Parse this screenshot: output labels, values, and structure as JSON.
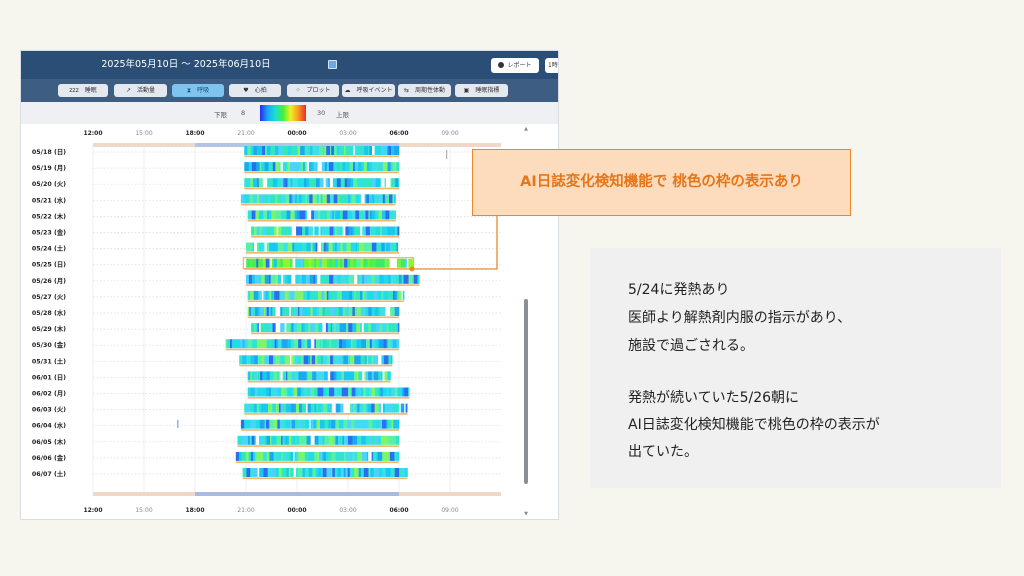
{
  "app": {
    "date_range": "2025年05月10日 〜 2025年06月10日",
    "report_button": "レポート",
    "period_button": "1時",
    "tabs": [
      {
        "icon": "zzz",
        "label": "睡眠",
        "active": false
      },
      {
        "icon": "↗",
        "label": "活動量",
        "active": false
      },
      {
        "icon": "lungs",
        "label": "呼吸",
        "active": true
      },
      {
        "icon": "♥",
        "label": "心拍",
        "active": false
      },
      {
        "icon": "⁘",
        "label": "プロット",
        "active": false
      },
      {
        "icon": "cloud",
        "label": "呼吸イベント",
        "active": false
      },
      {
        "icon": "⇆",
        "label": "周期性体動",
        "active": false
      },
      {
        "icon": "▣",
        "label": "睡眠指標",
        "active": false
      }
    ],
    "scale": {
      "lower_label": "下限",
      "lower_value": "8",
      "upper_value": "30",
      "upper_label": "上限"
    }
  },
  "chart_data": {
    "type": "heatmap",
    "time_ticks": [
      "12:00",
      "15:00",
      "18:00",
      "21:00",
      "00:00",
      "03:00",
      "06:00",
      "09:00"
    ],
    "time_ticks_bold": [
      true,
      false,
      true,
      false,
      true,
      false,
      true,
      false
    ],
    "rows": [
      {
        "date": "05/18 (日)",
        "start": 20.9,
        "end": 30.0,
        "highlight": false
      },
      {
        "date": "05/19 (月)",
        "start": 20.9,
        "end": 30.0,
        "highlight": false
      },
      {
        "date": "05/20 (火)",
        "start": 20.9,
        "end": 30.0,
        "highlight": false
      },
      {
        "date": "05/21 (水)",
        "start": 20.7,
        "end": 29.8,
        "highlight": false
      },
      {
        "date": "05/22 (木)",
        "start": 21.1,
        "end": 29.8,
        "highlight": false
      },
      {
        "date": "05/23 (金)",
        "start": 21.3,
        "end": 30.0,
        "highlight": false
      },
      {
        "date": "05/24 (土)",
        "start": 21.0,
        "end": 30.0,
        "highlight": false
      },
      {
        "date": "05/25 (日)",
        "start": 20.9,
        "end": 30.8,
        "highlight": true
      },
      {
        "date": "05/26 (月)",
        "start": 21.0,
        "end": 31.2,
        "highlight": false
      },
      {
        "date": "05/27 (火)",
        "start": 21.1,
        "end": 30.3,
        "highlight": false
      },
      {
        "date": "05/28 (水)",
        "start": 21.1,
        "end": 30.0,
        "highlight": false
      },
      {
        "date": "05/29 (木)",
        "start": 21.3,
        "end": 30.0,
        "highlight": false
      },
      {
        "date": "05/30 (金)",
        "start": 19.8,
        "end": 30.0,
        "highlight": false
      },
      {
        "date": "05/31 (土)",
        "start": 20.6,
        "end": 29.6,
        "highlight": false
      },
      {
        "date": "06/01 (日)",
        "start": 21.1,
        "end": 29.5,
        "highlight": false
      },
      {
        "date": "06/02 (月)",
        "start": 21.1,
        "end": 30.6,
        "highlight": false
      },
      {
        "date": "06/03 (火)",
        "start": 20.9,
        "end": 30.5,
        "highlight": false
      },
      {
        "date": "06/04 (水)",
        "start": 20.7,
        "end": 30.0,
        "highlight": false
      },
      {
        "date": "06/05 (木)",
        "start": 20.5,
        "end": 30.0,
        "highlight": false
      },
      {
        "date": "06/06 (金)",
        "start": 20.4,
        "end": 30.0,
        "highlight": false
      },
      {
        "date": "06/07 (土)",
        "start": 20.8,
        "end": 30.5,
        "highlight": false
      }
    ]
  },
  "callout": {
    "text": "AI日誌変化検知機能で 桃色の枠の表示あり"
  },
  "note": {
    "lines": [
      "5/24に発熱あり",
      "医師より解熱剤内服の指示があり、",
      "施設で過ごされる。",
      "",
      "発熱が続いていた5/26朝に",
      "AI日誌変化検知機能で桃色の枠の表示が",
      "出ていた。"
    ]
  },
  "colors": {
    "header": "#2b4e76",
    "tabbar": "#3d5d83",
    "active_tab": "#7fc4ef",
    "callout_fill": "#fcdcbc",
    "callout_border": "#e98a2a",
    "callout_text": "#e5761a",
    "highlight_frame": "#f5a742"
  }
}
